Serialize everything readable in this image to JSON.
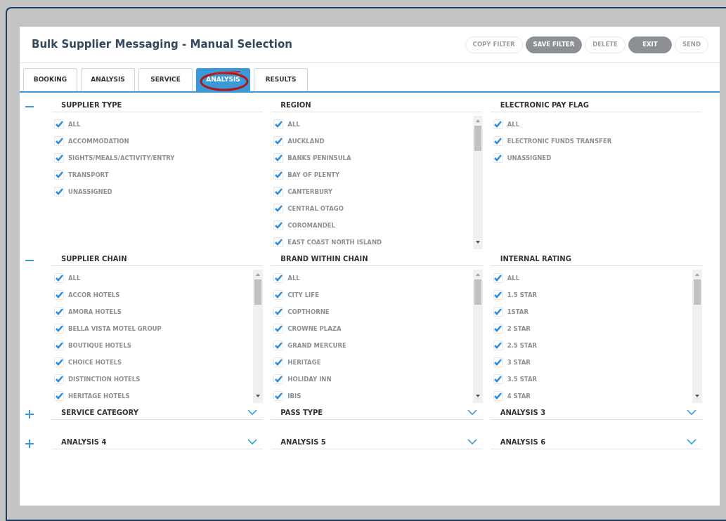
{
  "title": "Bulk Supplier Messaging - Manual Selection",
  "buttons": [
    {
      "label": "COPY FILTER",
      "disabled": true
    },
    {
      "label": "SAVE FILTER",
      "disabled": false
    },
    {
      "label": "DELETE",
      "disabled": true
    },
    {
      "label": "EXIT",
      "disabled": false
    },
    {
      "label": "SEND",
      "disabled": true
    }
  ],
  "tabs": [
    {
      "label": "BOOKING",
      "selected": false,
      "annotated": false
    },
    {
      "label": "ANALYSIS",
      "selected": false,
      "annotated": false
    },
    {
      "label": "SERVICE",
      "selected": false,
      "annotated": false
    },
    {
      "label": "ANALYSIS",
      "selected": true,
      "annotated": true
    },
    {
      "label": "RESULTS",
      "selected": false,
      "annotated": false
    }
  ],
  "groups": [
    {
      "expanded": true,
      "sections": [
        {
          "title": "SUPPLIER TYPE",
          "scrollable": false,
          "options": [
            {
              "label": "ALL",
              "checked": true
            },
            {
              "label": "ACCOMMODATION",
              "checked": true
            },
            {
              "label": "SIGHTS/MEALS/ACTIVITY/ENTRY",
              "checked": true
            },
            {
              "label": "TRANSPORT",
              "checked": true
            },
            {
              "label": "UNASSIGNED",
              "checked": true
            }
          ]
        },
        {
          "title": "REGION",
          "scrollable": true,
          "options": [
            {
              "label": "ALL",
              "checked": true
            },
            {
              "label": "AUCKLAND",
              "checked": true
            },
            {
              "label": "BANKS PENINSULA",
              "checked": true
            },
            {
              "label": "BAY OF PLENTY",
              "checked": true
            },
            {
              "label": "CANTERBURY",
              "checked": true
            },
            {
              "label": "CENTRAL OTAGO",
              "checked": true
            },
            {
              "label": "COROMANDEL",
              "checked": true
            },
            {
              "label": "EAST COAST NORTH ISLAND",
              "checked": true
            }
          ]
        },
        {
          "title": "ELECTRONIC PAY FLAG",
          "scrollable": false,
          "options": [
            {
              "label": "ALL",
              "checked": true
            },
            {
              "label": "ELECTRONIC FUNDS TRANSFER",
              "checked": true
            },
            {
              "label": "UNASSIGNED",
              "checked": true
            }
          ]
        }
      ]
    },
    {
      "expanded": true,
      "sections": [
        {
          "title": "SUPPLIER CHAIN",
          "scrollable": true,
          "options": [
            {
              "label": "ALL",
              "checked": true
            },
            {
              "label": "ACCOR HOTELS",
              "checked": true
            },
            {
              "label": "AMORA HOTELS",
              "checked": true
            },
            {
              "label": "BELLA VISTA MOTEL GROUP",
              "checked": true
            },
            {
              "label": "BOUTIQUE HOTELS",
              "checked": true
            },
            {
              "label": "CHOICE HOTELS",
              "checked": true
            },
            {
              "label": "DISTINCTION HOTELS",
              "checked": true
            },
            {
              "label": "HERITAGE HOTELS",
              "checked": true
            }
          ]
        },
        {
          "title": "BRAND WITHIN CHAIN",
          "scrollable": true,
          "options": [
            {
              "label": "ALL",
              "checked": true
            },
            {
              "label": "CITY LIFE",
              "checked": true
            },
            {
              "label": "COPTHORNE",
              "checked": true
            },
            {
              "label": "CROWNE PLAZA",
              "checked": true
            },
            {
              "label": "GRAND MERCURE",
              "checked": true
            },
            {
              "label": "HERITAGE",
              "checked": true
            },
            {
              "label": "HOLIDAY INN",
              "checked": true
            },
            {
              "label": "IBIS",
              "checked": true
            }
          ]
        },
        {
          "title": "INTERNAL RATING",
          "scrollable": true,
          "options": [
            {
              "label": "ALL",
              "checked": true
            },
            {
              "label": "1.5 STAR",
              "checked": true
            },
            {
              "label": "1STAR",
              "checked": true
            },
            {
              "label": "2 STAR",
              "checked": true
            },
            {
              "label": "2.5 STAR",
              "checked": true
            },
            {
              "label": "3 STAR",
              "checked": true
            },
            {
              "label": "3.5 STAR",
              "checked": true
            },
            {
              "label": "4 STAR",
              "checked": true
            }
          ]
        }
      ]
    },
    {
      "expanded": false,
      "sections": [
        {
          "title": "SERVICE CATEGORY"
        },
        {
          "title": "PASS TYPE"
        },
        {
          "title": "ANALYSIS 3"
        }
      ]
    },
    {
      "expanded": false,
      "sections": [
        {
          "title": "ANALYSIS 4"
        },
        {
          "title": "ANALYSIS 5"
        },
        {
          "title": "ANALYSIS 6"
        }
      ]
    }
  ]
}
